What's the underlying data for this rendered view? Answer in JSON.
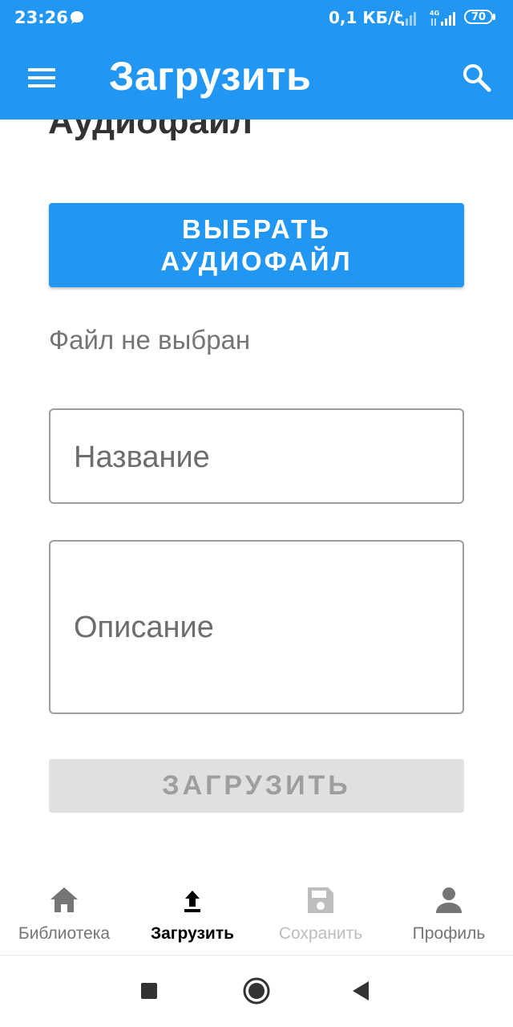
{
  "status_bar": {
    "time": "23:26",
    "network_speed": "0,1 КБ/с",
    "battery": "70"
  },
  "app_bar": {
    "title": "Загрузить",
    "menu_icon": "menu-icon",
    "search_icon": "search-icon"
  },
  "content": {
    "heading": "Аудиофайл",
    "pick_button_label": "ВЫБРАТЬ\nАУДИОФАЙЛ",
    "file_status": "Файл не выбран",
    "title_placeholder": "Название",
    "description_placeholder": "Описание",
    "upload_button_label": "ЗАГРУЗИТЬ"
  },
  "bottom_nav": {
    "items": [
      {
        "label": "Библиотека",
        "icon": "home-icon",
        "state": "normal"
      },
      {
        "label": "Загрузить",
        "icon": "upload-icon",
        "state": "active"
      },
      {
        "label": "Сохранить",
        "icon": "save-icon",
        "state": "disabled"
      },
      {
        "label": "Профиль",
        "icon": "person-icon",
        "state": "normal"
      }
    ]
  },
  "colors": {
    "primary": "#2196f3",
    "disabled_bg": "#e0e0e0",
    "disabled_text": "#9e9e9e"
  }
}
